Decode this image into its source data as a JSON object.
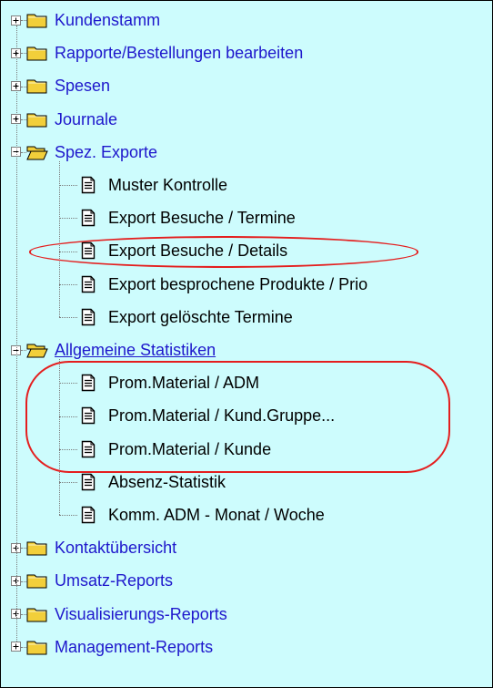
{
  "tree": {
    "nodes": [
      {
        "id": "kundenstamm",
        "label": "Kundenstamm",
        "type": "folder",
        "state": "collapsed"
      },
      {
        "id": "rapporte",
        "label": "Rapporte/Bestellungen bearbeiten",
        "type": "folder",
        "state": "collapsed"
      },
      {
        "id": "spesen",
        "label": "Spesen",
        "type": "folder",
        "state": "collapsed"
      },
      {
        "id": "journale",
        "label": "Journale",
        "type": "folder",
        "state": "collapsed"
      },
      {
        "id": "spez-exporte",
        "label": "Spez. Exporte",
        "type": "folder",
        "state": "expanded",
        "children": [
          {
            "id": "muster-kontrolle",
            "label": "Muster Kontrolle",
            "type": "document"
          },
          {
            "id": "export-besuche-termine",
            "label": "Export Besuche / Termine",
            "type": "document"
          },
          {
            "id": "export-besuche-details",
            "label": "Export Besuche / Details",
            "type": "document",
            "circled": true
          },
          {
            "id": "export-besprochene",
            "label": "Export besprochene Produkte / Prio",
            "type": "document"
          },
          {
            "id": "export-geloeschte",
            "label": "Export gelöschte Termine",
            "type": "document"
          }
        ]
      },
      {
        "id": "allgemeine-statistiken",
        "label": "Allgemeine Statistiken",
        "type": "folder",
        "state": "expanded",
        "highlighted": true,
        "children": [
          {
            "id": "prom-adm",
            "label": "Prom.Material / ADM",
            "type": "document",
            "circled": true
          },
          {
            "id": "prom-kund-gruppe",
            "label": "Prom.Material / Kund.Gruppe...",
            "type": "document",
            "circled": true
          },
          {
            "id": "prom-kunde",
            "label": "Prom.Material / Kunde",
            "type": "document",
            "circled": true
          },
          {
            "id": "absenz",
            "label": "Absenz-Statistik",
            "type": "document"
          },
          {
            "id": "komm-adm",
            "label": "Komm. ADM  - Monat / Woche",
            "type": "document"
          }
        ]
      },
      {
        "id": "kontakt",
        "label": "Kontaktübersicht",
        "type": "folder",
        "state": "collapsed"
      },
      {
        "id": "umsatz",
        "label": "Umsatz-Reports",
        "type": "folder",
        "state": "collapsed"
      },
      {
        "id": "visualisierung",
        "label": "Visualisierungs-Reports",
        "type": "folder",
        "state": "collapsed"
      },
      {
        "id": "management",
        "label": "Management-Reports",
        "type": "folder",
        "state": "collapsed"
      }
    ]
  },
  "colors": {
    "background": "#cdfcfd",
    "folder_label": "#1e17cc",
    "document_label": "#000000",
    "folder_icon": "#f2cf3a",
    "annotation_ring": "#e41e1e"
  },
  "icons": {
    "expand": "plus-box-icon",
    "collapse": "minus-box-icon",
    "folder_closed": "folder-icon",
    "folder_open": "folder-open-icon",
    "document": "document-icon"
  }
}
